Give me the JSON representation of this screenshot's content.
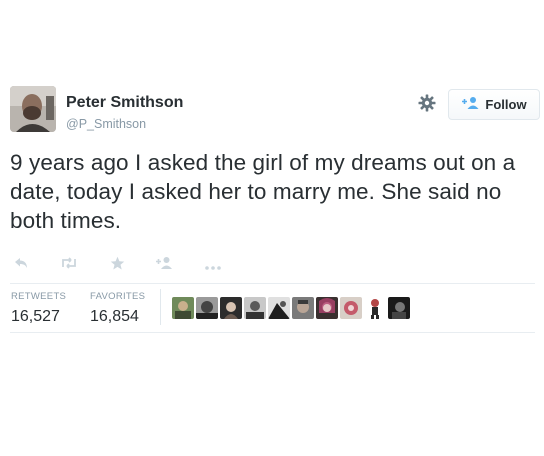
{
  "user": {
    "name": "Peter Smithson",
    "handle": "@P_Smithson"
  },
  "follow_button": {
    "label": "Follow"
  },
  "tweet": {
    "text": "9 years ago I asked the girl of my dreams out on a date, today I asked her to marry me. She said no both times."
  },
  "stats": {
    "retweets_label": "RETWEETS",
    "retweets_count": "16,527",
    "favorites_label": "FAVORITES",
    "favorites_count": "16,854"
  },
  "colors": {
    "text": "#292f33",
    "muted": "#8899a6",
    "action_icon": "#ccd6dd",
    "follow_icon": "#55acee"
  },
  "icons": [
    "gear-icon",
    "follow-person-plus-icon",
    "reply-icon",
    "retweet-icon",
    "favorite-star-icon",
    "follow-plus-icon",
    "more-dots-icon"
  ]
}
